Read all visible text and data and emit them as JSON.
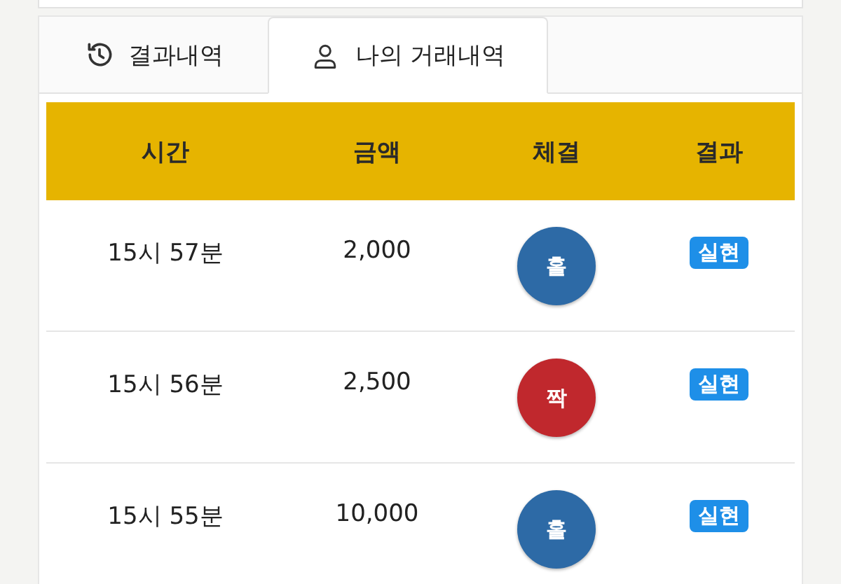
{
  "tabs": [
    {
      "label": "결과내역",
      "kind": "history",
      "selected": false
    },
    {
      "label": "나의 거래내역",
      "kind": "user",
      "selected": true
    }
  ],
  "table": {
    "columns": [
      "시간",
      "금액",
      "체결",
      "결과"
    ],
    "rows": [
      {
        "time": "15시 57분",
        "amount": "2,000",
        "pick": "홀",
        "color": "#2d6aa6",
        "result": "실현"
      },
      {
        "time": "15시 56분",
        "amount": "2,500",
        "pick": "짝",
        "color": "#c0282d",
        "result": "실현"
      },
      {
        "time": "15시 55분",
        "amount": "10,000",
        "pick": "홀",
        "color": "#2d6aa6",
        "result": "실현"
      }
    ]
  }
}
